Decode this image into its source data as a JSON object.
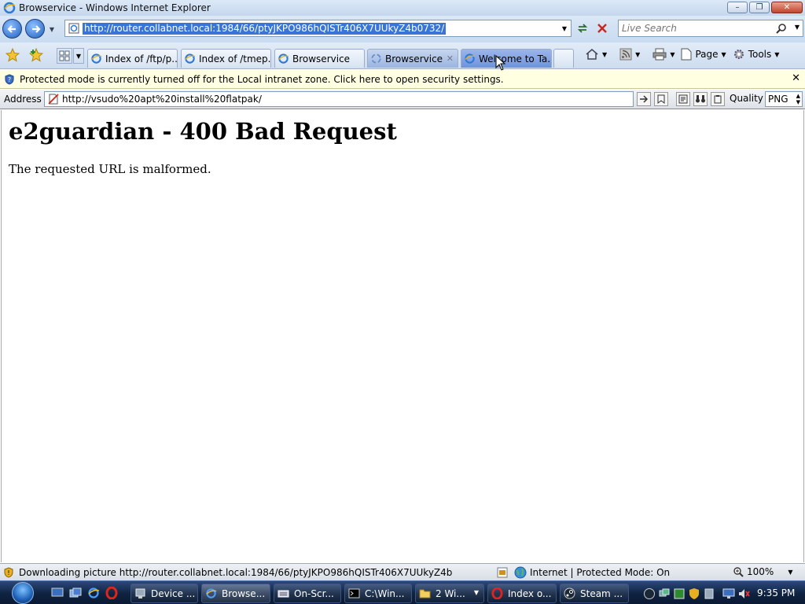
{
  "window": {
    "title": "Browservice - Windows Internet Explorer"
  },
  "nav": {
    "url": "http://router.collabnet.local:1984/66/ptyJKPO986hQISTr406X7UUkyZ4b0732/",
    "search_placeholder": "Live Search"
  },
  "tabs": [
    {
      "label": "Index of /ftp/p..."
    },
    {
      "label": "Index of /tmep..."
    },
    {
      "label": "Browservice"
    },
    {
      "label": "Browservice"
    },
    {
      "label": "Welcome to Ta..."
    }
  ],
  "command_bar": {
    "page_label": "Page",
    "tools_label": "Tools"
  },
  "infobar": {
    "message": "Protected mode is currently turned off for the Local intranet zone.  Click here to open security settings."
  },
  "address_bar": {
    "label": "Address",
    "value": "http://vsudo%20apt%20install%20flatpak/",
    "quality_label": "Quality",
    "quality_value": "PNG"
  },
  "page": {
    "heading": "e2guardian - 400 Bad Request",
    "body": "The requested URL is malformed."
  },
  "status": {
    "text": "Downloading picture http://router.collabnet.local:1984/66/ptyJKPO986hQISTr406X7UUkyZ4b",
    "zone": "Internet | Protected Mode: On",
    "zoom": "100%"
  },
  "taskbar": {
    "items": [
      {
        "label": "Device ..."
      },
      {
        "label": "Browse..."
      },
      {
        "label": "On-Scr..."
      },
      {
        "label": "C:\\Win..."
      },
      {
        "label": "2 Wi..."
      },
      {
        "label": "Index o..."
      },
      {
        "label": "Steam ..."
      }
    ],
    "clock": "9:35 PM"
  }
}
